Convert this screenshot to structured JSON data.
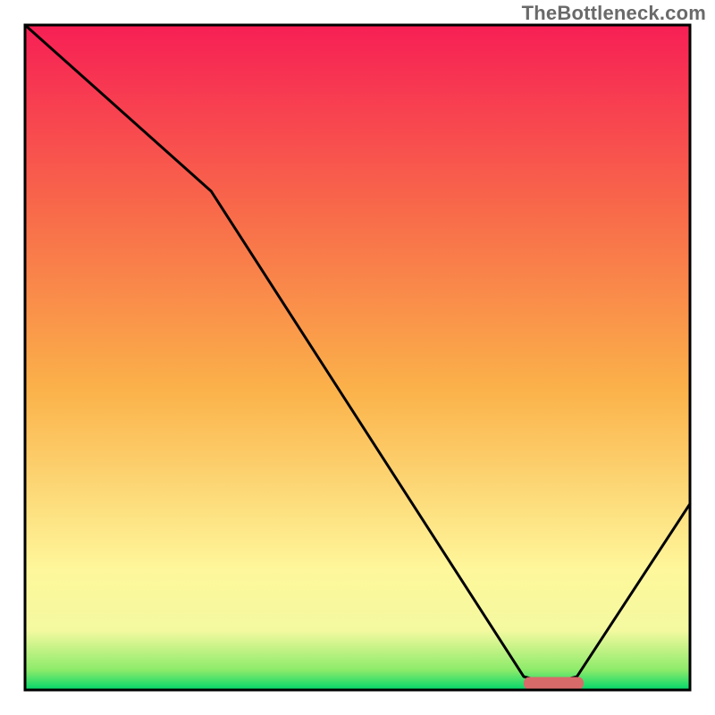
{
  "watermark": "TheBottleneck.com",
  "chart_data": {
    "type": "line",
    "title": "",
    "xlabel": "",
    "ylabel": "",
    "xlim": [
      0,
      100
    ],
    "ylim": [
      0,
      100
    ],
    "legend": [],
    "gradient": {
      "stops": [
        {
          "offset": 0,
          "color": "#00d66a"
        },
        {
          "offset": 3,
          "color": "#8ceb6a"
        },
        {
          "offset": 9,
          "color": "#f4f9a0"
        },
        {
          "offset": 18,
          "color": "#fef79b"
        },
        {
          "offset": 45,
          "color": "#fbb24a"
        },
        {
          "offset": 72,
          "color": "#f86a4a"
        },
        {
          "offset": 100,
          "color": "#f71f55"
        }
      ]
    },
    "series": [
      {
        "name": "bottleneck-curve",
        "color": "#000000",
        "x": [
          0,
          28,
          75,
          79,
          83,
          100
        ],
        "values": [
          100,
          75,
          2,
          1,
          2,
          28
        ]
      }
    ],
    "marker": {
      "name": "sweet-spot",
      "x_start": 75,
      "x_end": 84,
      "y": 1,
      "color": "#d86a6a"
    },
    "frame": {
      "x": 3.5,
      "y": 3.5,
      "width": 93,
      "height": 93,
      "stroke": "#000000"
    }
  }
}
